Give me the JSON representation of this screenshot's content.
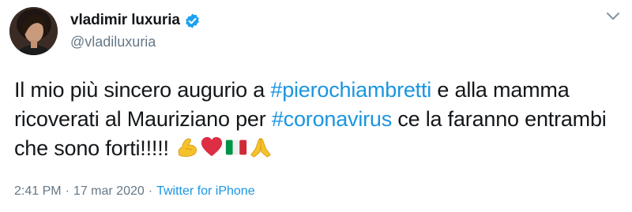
{
  "tweet": {
    "display_name": "vladimir luxuria",
    "handle": "@vladiluxuria",
    "text_part1": "Il mio più sincero augurio a ",
    "hashtag1": "#pierochiambretti",
    "text_part2": " e alla mamma ricoverati al Mauriziano per ",
    "hashtag2": "#coronavirus",
    "text_part3": " ce la faranno entrambi che sono forti!!!!! ",
    "emojis": [
      "flexed-biceps-icon",
      "red-heart-icon",
      "italy-flag-icon",
      "folded-hands-icon"
    ],
    "time": "2:41 PM",
    "separator1": "·",
    "date": "17 mar 2020",
    "separator2": "·",
    "source": "Twitter for iPhone"
  },
  "colors": {
    "link": "#1b95e0",
    "text": "#14171a",
    "secondary": "#657786",
    "verified": "#1da1f2"
  }
}
